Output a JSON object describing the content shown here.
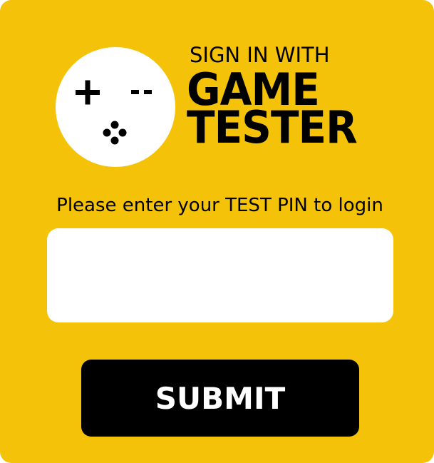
{
  "header": {
    "sign_in_with": "SIGN IN WITH",
    "brand_line_1": "GAME",
    "brand_line_2": "TESTER",
    "logo_icon": "gamepad-icon"
  },
  "form": {
    "instruction": "Please enter your TEST PIN to login",
    "pin_value": "",
    "pin_placeholder": "",
    "submit_label": "SUBMIT"
  },
  "colors": {
    "background": "#F5C20A",
    "text": "#000000",
    "input_bg": "#FFFFFF",
    "button_bg": "#000000",
    "button_text": "#FFFFFF"
  }
}
